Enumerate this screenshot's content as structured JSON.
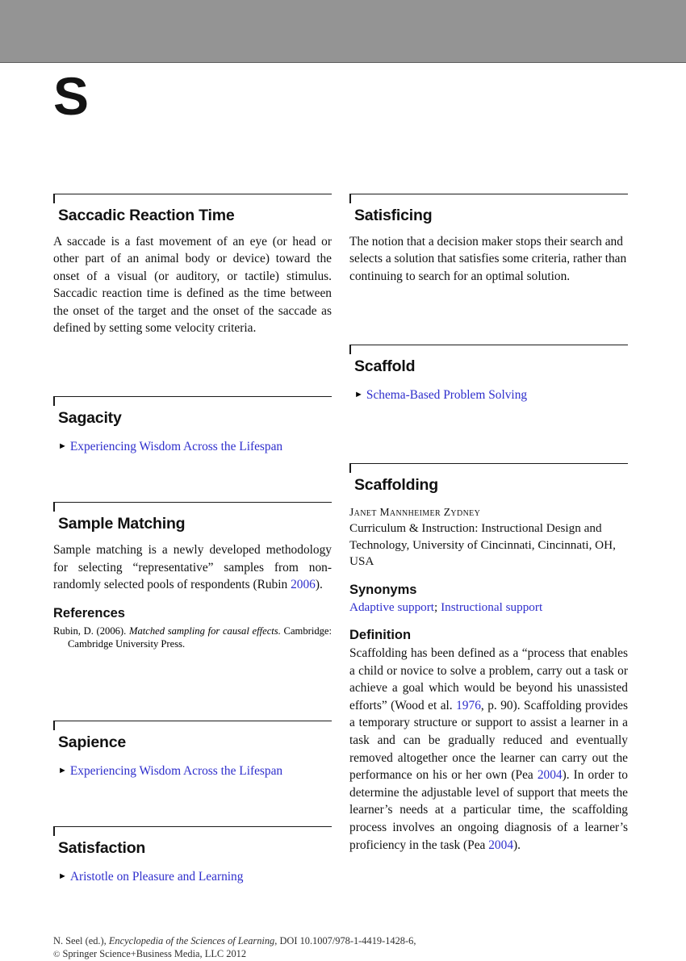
{
  "page": {
    "letter": "S",
    "banner_color": "#949494",
    "link_color": "#2e2ecc"
  },
  "left_column": {
    "entries": [
      {
        "title": "Saccadic Reaction Time",
        "body": "A saccade is a fast movement of an eye (or head or other part of an animal body or device) toward the onset of a visual (or auditory, or tactile) stimulus. Saccadic reaction time is defined as the time between the onset of the target and the onset of the saccade as defined by setting some velocity criteria."
      },
      {
        "title": "Sagacity",
        "see_also": "Experiencing Wisdom Across the Lifespan"
      },
      {
        "title": "Sample Matching",
        "body_pre": "Sample matching is a newly developed methodology for selecting “representative” samples from non-randomly selected pools of respondents (Rubin ",
        "body_cite": "2006",
        "body_post": ").",
        "references_heading": "References",
        "reference_1_a": "Rubin, D. (2006). ",
        "reference_1_italic": "Matched sampling for causal effects.",
        "reference_1_b": " Cambridge: Cambridge University Press."
      },
      {
        "title": "Sapience",
        "see_also": "Experiencing Wisdom Across the Lifespan"
      },
      {
        "title": "Satisfaction",
        "see_also": "Aristotle on Pleasure and Learning"
      }
    ]
  },
  "right_column": {
    "entries": [
      {
        "title": "Satisficing",
        "body": "The notion that a decision maker stops their search and selects a solution that satisfies some criteria, rather than continuing to search for an optimal solution."
      },
      {
        "title": "Scaffold",
        "see_also": "Schema-Based Problem Solving"
      },
      {
        "title": "Scaffolding",
        "author": "Janet Mannheimer Zydney",
        "affiliation": "Curriculum & Instruction: Instructional Design and Technology, University of Cincinnati, Cincinnati, OH, USA",
        "synonyms_heading": "Synonyms",
        "synonym_1": "Adaptive support",
        "synonym_sep": "; ",
        "synonym_2": "Instructional support",
        "definition_heading": "Definition",
        "definition_p1": "Scaffolding has been defined as a “process that enables a child or novice to solve a problem, carry out a task or achieve a goal which would be beyond his unassisted efforts” (Wood et al. ",
        "definition_cite1": "1976",
        "definition_p2": ", p. 90). Scaffolding provides a temporary structure or support to assist a learner in a task and can be gradually reduced and eventually removed altogether once the learner can carry out the performance on his or her own (Pea ",
        "definition_cite2": "2004",
        "definition_p3": "). In order to determine the adjustable level of support that meets the learner’s needs at a particular time, the scaffolding process involves an ongoing diagnosis of a learner’s proficiency in the task (Pea ",
        "definition_cite3": "2004",
        "definition_p4": ")."
      }
    ]
  },
  "footer": {
    "line1_a": "N. Seel (ed.), ",
    "line1_italic": "Encyclopedia of the Sciences of Learning",
    "line1_b": ", DOI 10.1007/978-1-4419-1428-6,",
    "line2_symbol": "©",
    "line2_text": " Springer Science+Business Media, LLC 2012"
  }
}
